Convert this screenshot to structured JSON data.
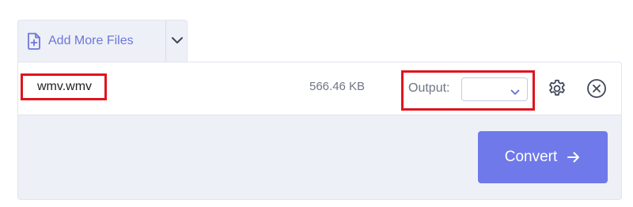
{
  "toolbar": {
    "add_files_label": "Add More Files",
    "add_files_icon": "file-plus-icon",
    "dropdown_icon": "chevron-down-icon"
  },
  "file": {
    "name": "wmv.wmv",
    "size": "566.46 KB",
    "output_label": "Output:",
    "output_value": "",
    "settings_icon": "gear-icon",
    "remove_icon": "close-circle-icon"
  },
  "actions": {
    "convert_label": "Convert",
    "convert_icon": "arrow-right-icon"
  },
  "colors": {
    "accent": "#6f79ea",
    "link": "#6c77d8",
    "highlight": "#e0141e",
    "panel_bg": "#eef0f7"
  }
}
